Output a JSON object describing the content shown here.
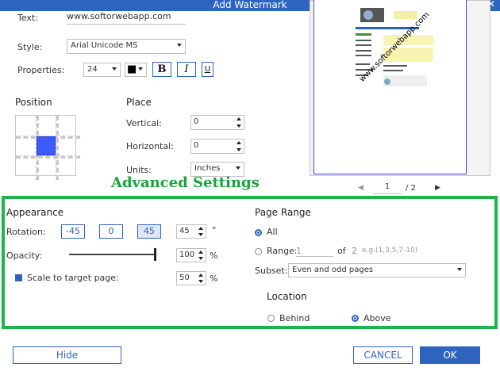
{
  "window": {
    "title": "Add Watermark",
    "close_glyph": "✕"
  },
  "text_row": {
    "label": "Text:",
    "value": "www.softorwebapp.com"
  },
  "style_row": {
    "label": "Style:",
    "value": "Arial Unicode MS"
  },
  "properties_row": {
    "label": "Properties:",
    "font_size": "24",
    "color_label": "■",
    "bold": "B",
    "italic": "I",
    "underline": "U"
  },
  "position": {
    "heading": "Position",
    "selected_cell": "center"
  },
  "place": {
    "heading": "Place",
    "vertical_label": "Vertical:",
    "vertical_value": "0",
    "horizontal_label": "Horizontal:",
    "horizontal_value": "0",
    "units_label": "Units:",
    "units_value": "Inches"
  },
  "preview": {
    "page_current": "1",
    "page_total": "/ 2",
    "watermark_text": "www.softorwebapp.com",
    "prev_glyph": "◀",
    "next_glyph": "▶"
  },
  "advanced": {
    "title": "Advanced Settings"
  },
  "appearance": {
    "heading": "Appearance",
    "rotation_label": "Rotation:",
    "rot_options": [
      "-45",
      "0",
      "45"
    ],
    "rotation_value": "45",
    "degree_symbol": "°",
    "opacity_label": "Opacity:",
    "opacity_value": "100",
    "opacity_fraction": 1.0,
    "scale_label": "Scale to target page:",
    "scale_value": "50",
    "percent": "%"
  },
  "page_range": {
    "heading": "Page Range",
    "all_label": "All",
    "range_label": "Range:",
    "range_value": "1",
    "of_label": "of",
    "of_total": "2",
    "range_hint": "e.g.(1,3,5,7-10)",
    "subset_label": "Subset:",
    "subset_value": "Even and odd pages"
  },
  "location": {
    "heading": "Location",
    "behind_label": "Behind",
    "above_label": "Above"
  },
  "footer": {
    "hide_label": "Hide",
    "cancel_label": "CANCEL",
    "ok_label": "OK"
  },
  "colors": {
    "accent": "#2f63c0",
    "green": "#1fb34b",
    "preview_marker": "#3d5afe"
  }
}
